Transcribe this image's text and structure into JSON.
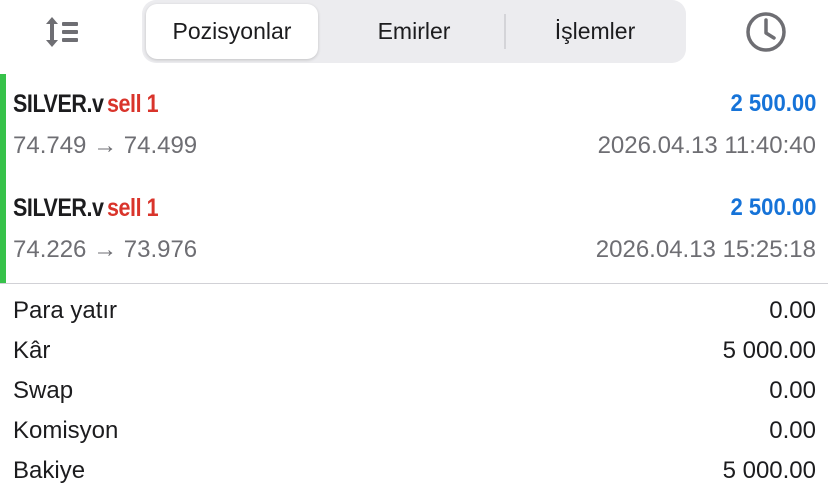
{
  "toolbar": {
    "sort_icon": "sort-arrows-icon",
    "history_icon": "clock-icon",
    "tabs": [
      {
        "label": "Pozisyonlar",
        "active": true
      },
      {
        "label": "Emirler",
        "active": false
      },
      {
        "label": "İşlemler",
        "active": false
      }
    ]
  },
  "positions": [
    {
      "symbol": "SILVER.v",
      "side": "sell 1",
      "profit": "2 500.00",
      "prices": "74.749 → 74.499",
      "time": "2026.04.13 11:40:40"
    },
    {
      "symbol": "SILVER.v",
      "side": "sell 1",
      "profit": "2 500.00",
      "prices": "74.226 → 73.976",
      "time": "2026.04.13 15:25:18"
    }
  ],
  "summary": [
    {
      "label": "Para yatır",
      "value": "0.00"
    },
    {
      "label": "Kâr",
      "value": "5 000.00"
    },
    {
      "label": "Swap",
      "value": "0.00"
    },
    {
      "label": "Komisyon",
      "value": "0.00"
    },
    {
      "label": "Bakiye",
      "value": "5 000.00"
    }
  ],
  "colors": {
    "profit": "#1673d8",
    "sell": "#d9342b",
    "position_marker": "#37c24a"
  }
}
